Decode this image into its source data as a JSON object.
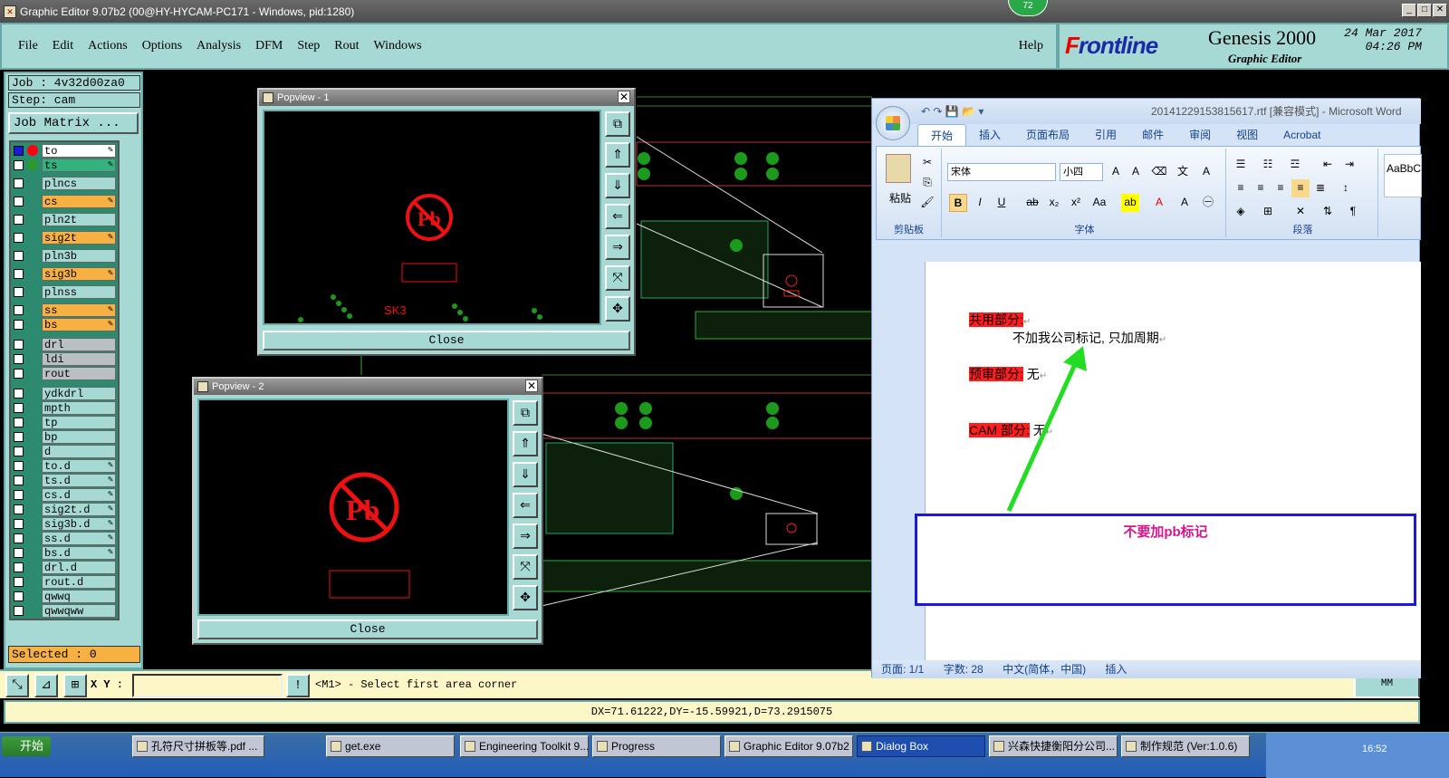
{
  "window": {
    "title": "Graphic Editor 9.07b2 (00@HY-HYCAM-PC171 - Windows, pid:1280)",
    "badge": "72"
  },
  "menu": {
    "items": [
      "File",
      "Edit",
      "Actions",
      "Options",
      "Analysis",
      "DFM",
      "Step",
      "Rout",
      "Windows"
    ],
    "help": "Help"
  },
  "brand": {
    "logo_left": "F",
    "logo_rest": "rontline",
    "product": "Genesis 2000",
    "subtitle": "Graphic Editor",
    "date": "24 Mar 2017",
    "time": "04:26 PM"
  },
  "job": {
    "job": "Job : 4v32d00za0",
    "step": "Step: cam",
    "matrix": "Job Matrix ..."
  },
  "layers": [
    "to",
    "ts",
    "plncs",
    "cs",
    "pln2t",
    "sig2t",
    "pln3b",
    "sig3b",
    "plnss",
    "ss",
    "bs",
    "drl",
    "ldi",
    "rout",
    "ydkdrl",
    "mpth",
    "tp",
    "bp",
    "d",
    "to.d",
    "ts.d",
    "cs.d",
    "sig2t.d",
    "sig3b.d",
    "ss.d",
    "bs.d",
    "drl.d",
    "rout.d",
    "qwwq",
    "qwwqww"
  ],
  "selected": "Selected : 0",
  "tools": {
    "xy_label": "X Y :",
    "prompt": "<M1> - Select first area corner",
    "mm": "MM"
  },
  "status": {
    "measure": "DX=71.61222,DY=-15.59921,D=73.2915075"
  },
  "popview1": {
    "title": "Popview - 1",
    "close": "Close",
    "silk": "SK3"
  },
  "popview2": {
    "title": "Popview - 2",
    "close": "Close"
  },
  "word": {
    "title": "20141229153815617.rtf [兼容模式] - Microsoft Word",
    "tabs": [
      "开始",
      "插入",
      "页面布局",
      "引用",
      "邮件",
      "审阅",
      "视图",
      "Acrobat"
    ],
    "groups": {
      "clipboard": "剪贴板",
      "font": "字体",
      "paragraph": "段落",
      "paste": "粘贴"
    },
    "font_name": "宋体",
    "font_size": "小四",
    "style_preview": "AaBbC",
    "doc": {
      "l1_label": "共用部分:",
      "l1_text": "不加我公司标记, 只加周期",
      "l2_label": "预审部分:",
      "l2_text": "无",
      "l3_label": "CAM 部分:",
      "l3_text": "无"
    },
    "statusbar": {
      "page": "页面: 1/1",
      "words": "字数: 28",
      "lang": "中文(简体，中国)",
      "mode": "插入"
    }
  },
  "note": "不要加pb标记",
  "taskbar": {
    "start": "开始",
    "tasks": [
      "孔符尺寸拼板等.pdf ...",
      "get.exe",
      "Engineering Toolkit 9....",
      "Progress",
      "Graphic Editor 9.07b2 ...",
      "Dialog Box",
      "兴森快捷衡阳分公司...",
      "制作规范 (Ver:1.0.6)"
    ],
    "clock": "16:52"
  },
  "colors": {
    "panel": "#a6d9d4",
    "red_hl": "#ff1d1d",
    "note_border": "#1a1ad8",
    "note_text": "#d6148c",
    "arrow": "#22dd22"
  }
}
